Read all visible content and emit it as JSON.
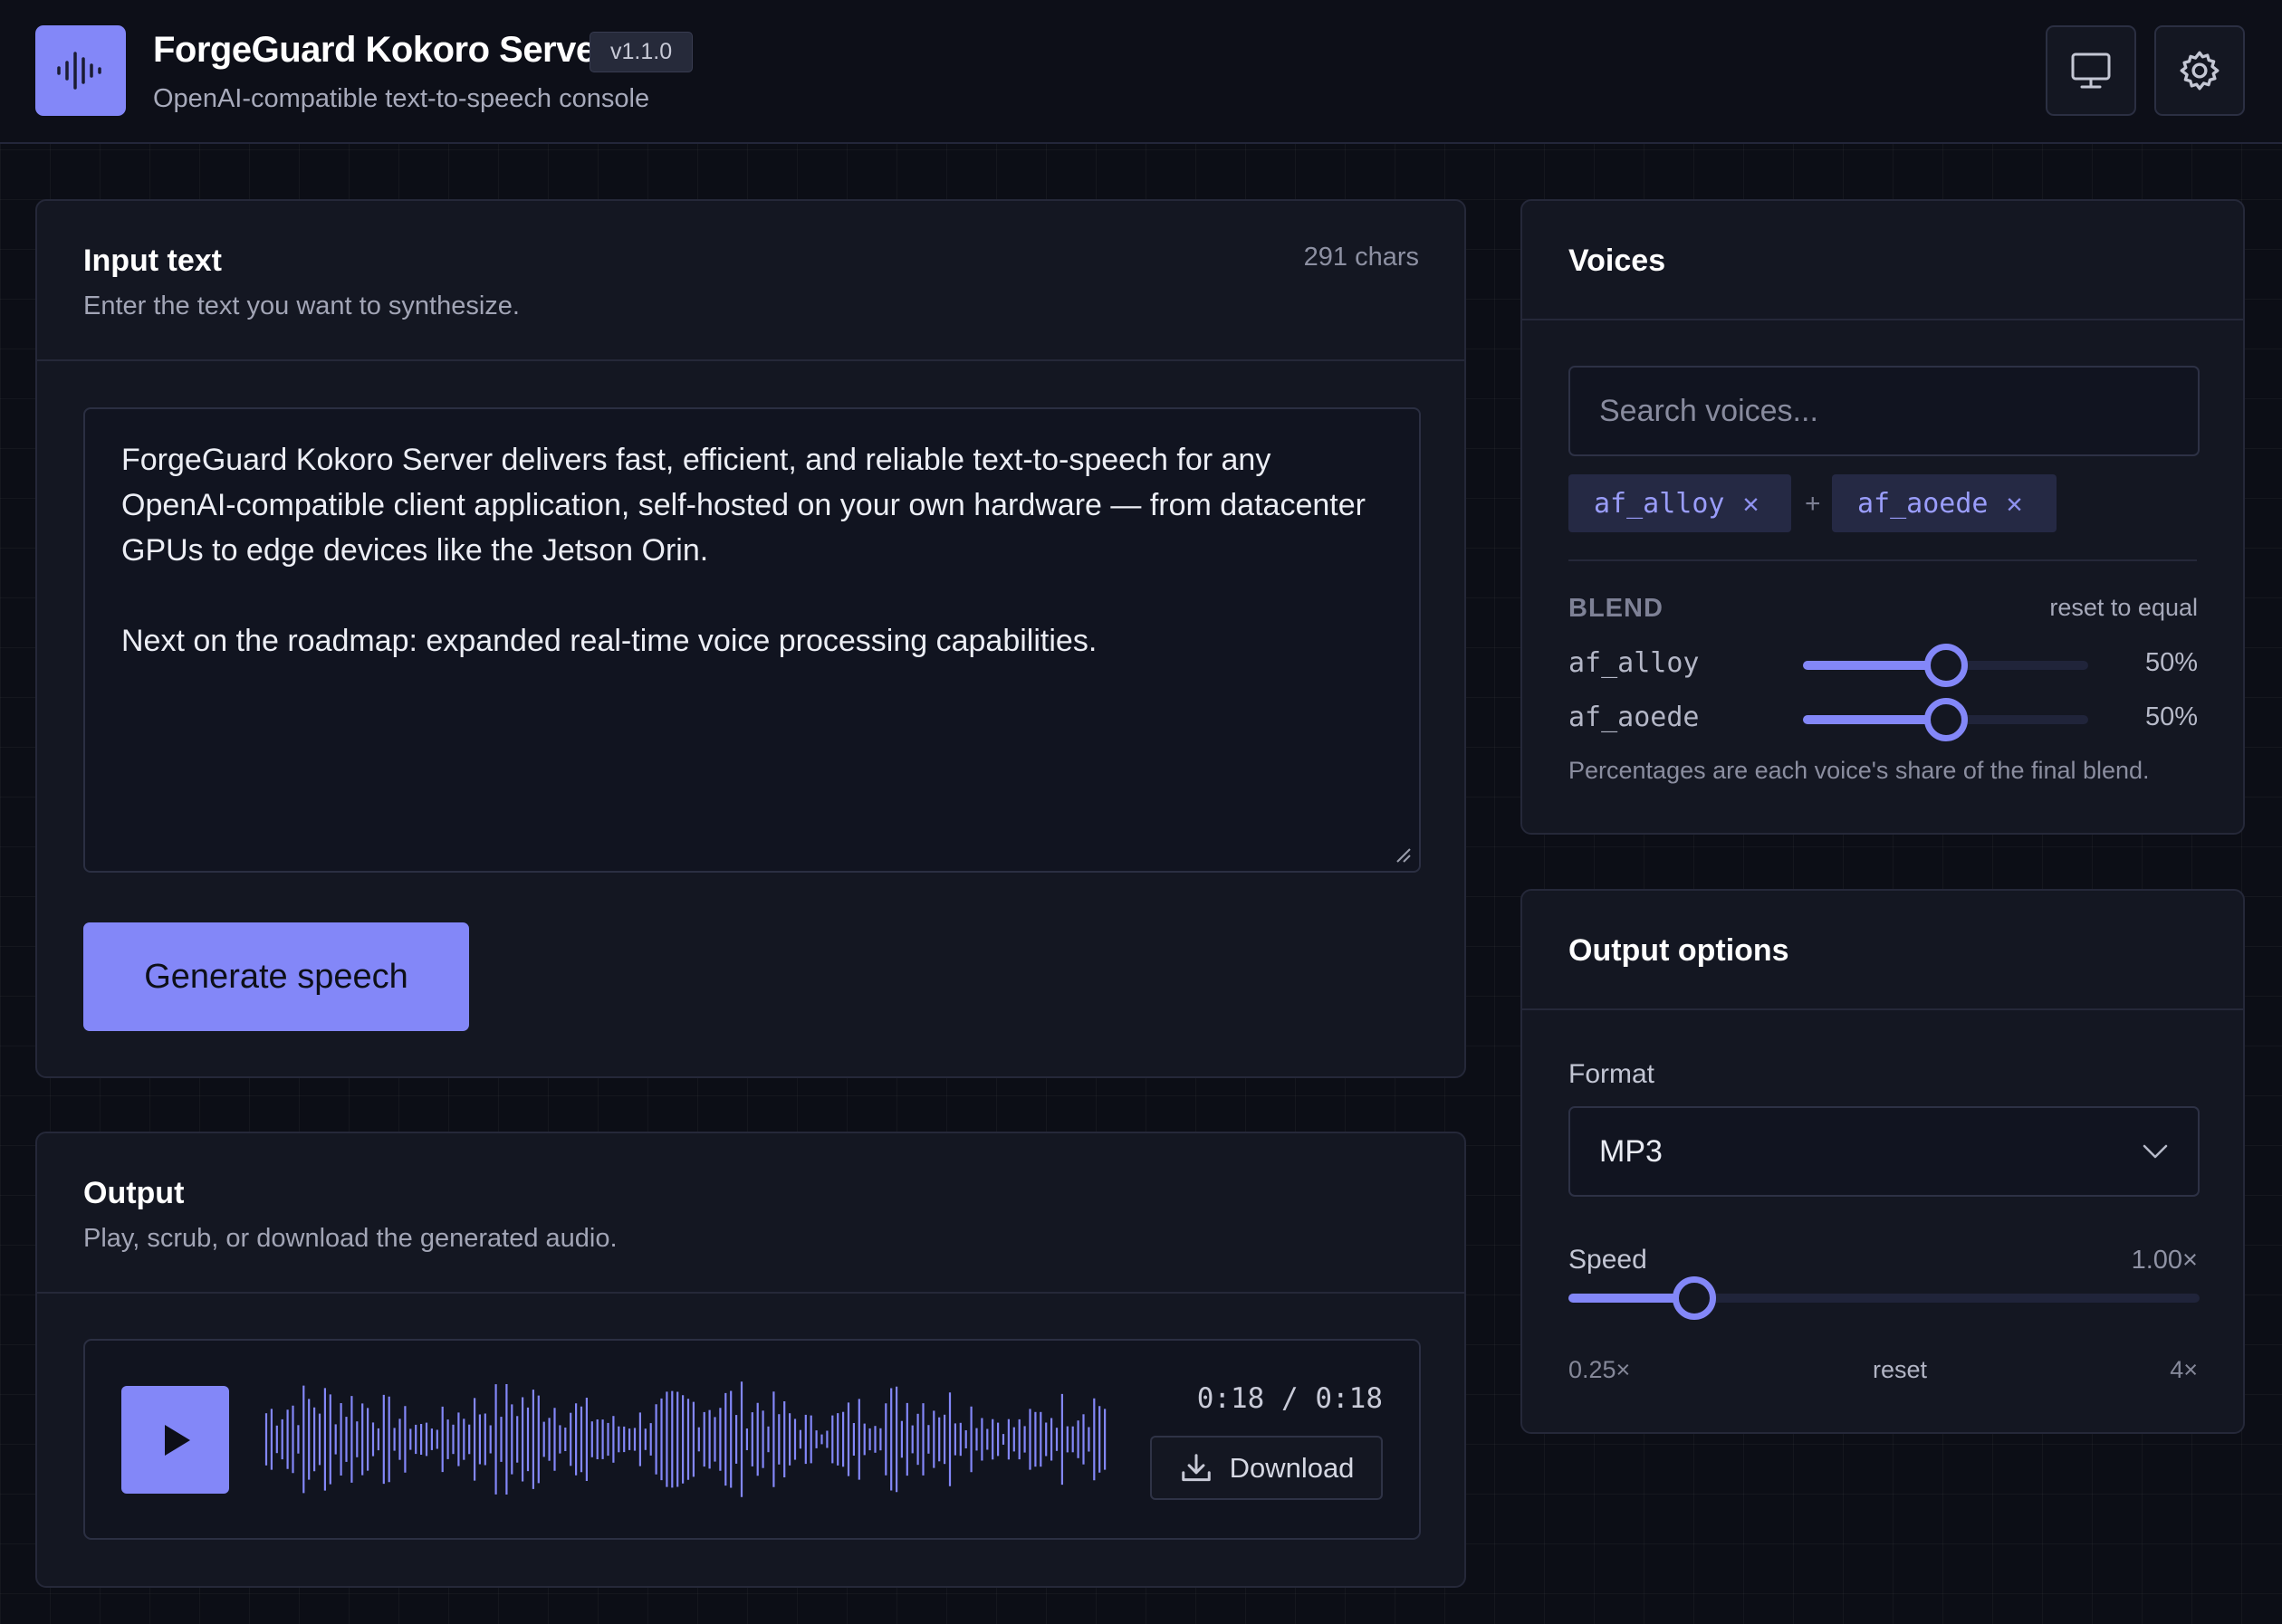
{
  "colors": {
    "accent": "#8387f8",
    "background": "#0c0e16",
    "card": "#141722"
  },
  "header": {
    "title": "ForgeGuard Kokoro Server",
    "version": "v1.1.0",
    "subtitle": "OpenAI-compatible text-to-speech console",
    "logo_icon": "waveform-icon",
    "buttons": [
      {
        "icon": "monitor-icon"
      },
      {
        "icon": "gear-icon"
      }
    ]
  },
  "input": {
    "title": "Input text",
    "description": "Enter the text you want to synthesize.",
    "char_count": "291 chars",
    "text_paragraph_1": "ForgeGuard Kokoro Server delivers fast, efficient, and reliable text-to-speech for any OpenAI-compatible client application, self-hosted on your own hardware — from datacenter GPUs to edge devices like the Jetson Orin.",
    "text_paragraph_2": "Next on the roadmap: expanded real-time voice processing capabilities.",
    "generate_label": "Generate speech"
  },
  "output": {
    "title": "Output",
    "description": "Play, scrub, or download the generated audio.",
    "time": "0:18 / 0:18",
    "download_label": "Download",
    "progress": 1.0
  },
  "voices": {
    "title": "Voices",
    "search_placeholder": "Search voices...",
    "chips": [
      {
        "name": "af_alloy"
      },
      {
        "name": "af_aoede"
      }
    ],
    "chip_separator": "+",
    "blend_label": "BLEND",
    "reset_label": "reset to equal",
    "blend": [
      {
        "name": "af_alloy",
        "percent": 50,
        "percent_label": "50%"
      },
      {
        "name": "af_aoede",
        "percent": 50,
        "percent_label": "50%"
      }
    ],
    "note": "Percentages are each voice's share of the final blend."
  },
  "options": {
    "title": "Output options",
    "format_label": "Format",
    "format_value": "MP3",
    "speed_label": "Speed",
    "speed_value": "1.00×",
    "speed": 1.0,
    "speed_min": 0.25,
    "speed_max": 4,
    "speed_min_label": "0.25×",
    "speed_reset_label": "reset",
    "speed_max_label": "4×"
  }
}
